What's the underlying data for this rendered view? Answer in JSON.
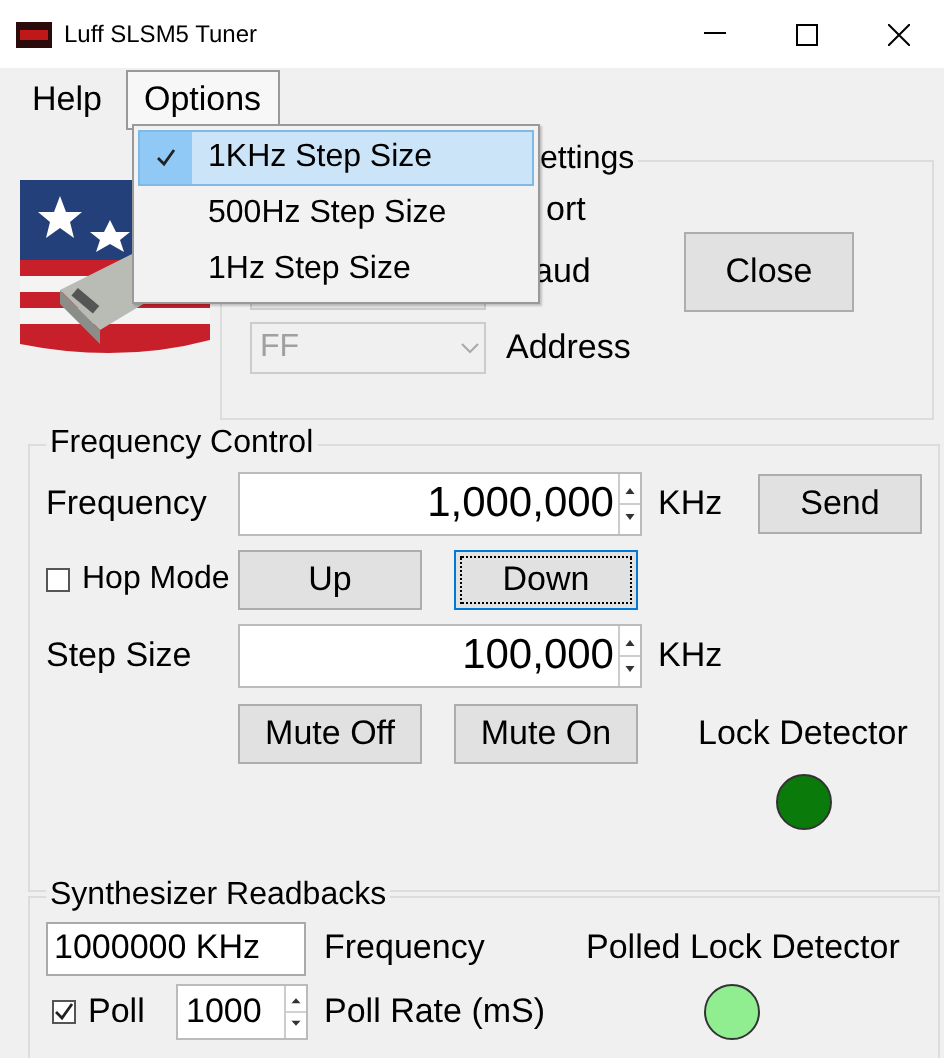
{
  "window": {
    "title": "Luff SLSM5 Tuner"
  },
  "menu_bar": [
    {
      "label": "Help",
      "open": false
    },
    {
      "label": "Options",
      "open": true
    }
  ],
  "options_menu": {
    "items": [
      {
        "label": "1KHz Step Size",
        "checked": true,
        "selected": true
      },
      {
        "label": "500Hz Step Size",
        "checked": false,
        "selected": false
      },
      {
        "label": "1Hz Step Size",
        "checked": false,
        "selected": false
      }
    ]
  },
  "settings": {
    "title": "ettings",
    "port_label": "ort",
    "baud_label": "aud",
    "close_button": "Close",
    "address": {
      "value": "FF",
      "disabled": true
    },
    "address_label": "Address"
  },
  "frequency_control": {
    "title": "Frequency Control",
    "frequency_label": "Frequency",
    "frequency": "1,000,000",
    "frequency_unit": "KHz",
    "send_button": "Send",
    "hop_mode": {
      "label": "Hop Mode",
      "checked": false
    },
    "up_button": "Up",
    "down_button": {
      "label": "Down",
      "focused": true
    },
    "step_label": "Step Size",
    "step": "100,000",
    "step_unit": "KHz",
    "mute_off_button": "Mute Off",
    "mute_on_button": "Mute On",
    "lock_label": "Lock Detector",
    "lock_lit": true
  },
  "readbacks": {
    "title": "Synthesizer Readbacks",
    "frequency": "1000000 KHz",
    "frequency_label": "Frequency",
    "polled_lock_label": "Polled Lock Detector",
    "poll": {
      "label": "Poll",
      "checked": true
    },
    "poll_rate": "1000",
    "poll_rate_label": "Poll Rate (mS)",
    "polled_lock_lit": false
  }
}
